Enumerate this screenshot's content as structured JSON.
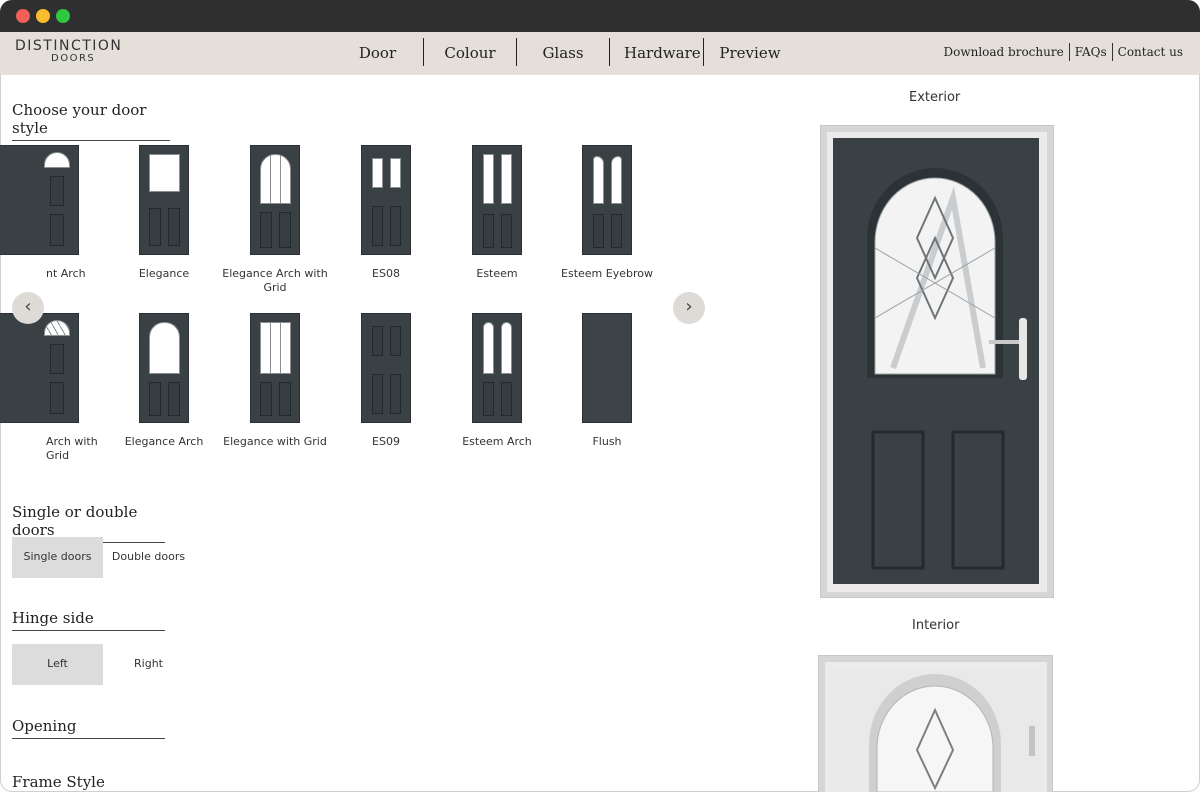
{
  "brand": {
    "line1": "DISTINCTION",
    "line2": "DOORS"
  },
  "nav": {
    "door": "Door",
    "colour": "Colour",
    "glass": "Glass",
    "hardware": "Hardware",
    "preview": "Preview"
  },
  "links": {
    "brochure": "Download brochure",
    "faqs": "FAQs",
    "contact": "Contact us"
  },
  "sections": {
    "door_style": "Choose your door style",
    "single_double": "Single or double doors",
    "hinge": "Hinge side",
    "opening": "Opening",
    "frame": "Frame Style"
  },
  "door_styles_row1": [
    "nt Arch",
    "Elegance",
    "Elegance Arch with Grid",
    "ES08",
    "Esteem",
    "Esteem Eyebrow"
  ],
  "door_styles_row2": [
    "Arch with Grid",
    "Elegance Arch",
    "Elegance with Grid",
    "ES09",
    "Esteem Arch",
    "Flush"
  ],
  "options": {
    "single": "Single doors",
    "double": "Double doors",
    "left": "Left",
    "right": "Right"
  },
  "arrows": {
    "prev": "‹",
    "next": "›"
  },
  "preview": {
    "exterior": "Exterior",
    "interior": "Interior"
  },
  "colors": {
    "door": "#3a4145",
    "navbar": "#e4dfd9",
    "selected": "#dcdcdc"
  }
}
